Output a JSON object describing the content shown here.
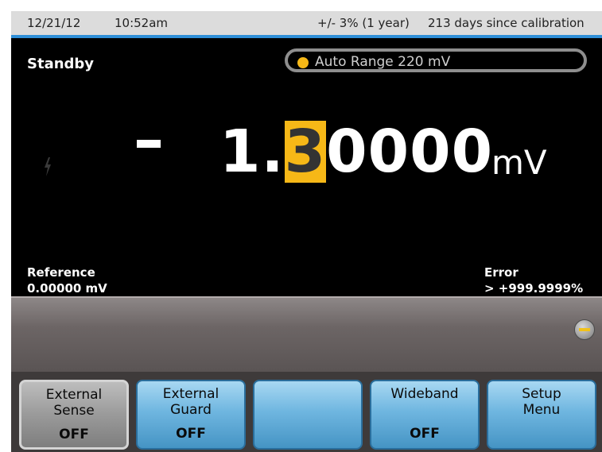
{
  "status_bar": {
    "date": "12/21/12",
    "time": "10:52am",
    "accuracy": "+/- 3% (1 year)",
    "calibration": "213 days since calibration"
  },
  "main": {
    "mode": "Standby",
    "range": "Auto Range 220 mV",
    "sign": "-",
    "reading_prefix": "1.",
    "reading_cursor": "3",
    "reading_suffix": "0000",
    "unit": "mV",
    "reference_label": "Reference",
    "reference_value": "0.00000 mV",
    "error_label": "Error",
    "error_value": "> +999.9999%"
  },
  "softkeys": [
    {
      "line1": "External",
      "line2": "Sense",
      "state": "OFF"
    },
    {
      "line1": "External",
      "line2": "Guard",
      "state": "OFF"
    },
    {
      "line1": "",
      "line2": "",
      "state": ""
    },
    {
      "line1": "Wideband",
      "line2": "",
      "state": "OFF"
    },
    {
      "line1": "Setup",
      "line2": "Menu",
      "state": ""
    }
  ],
  "colors": {
    "accent": "#2f8fd8",
    "highlight": "#f6b817",
    "softkey_blue": "#6fb6e0",
    "softkey_selected": "#9a9a9a"
  },
  "icons": {
    "range_indicator": "status-dot-icon",
    "hazard": "lightning-bolt-icon",
    "panel_indicator": "minus-indicator-icon"
  }
}
